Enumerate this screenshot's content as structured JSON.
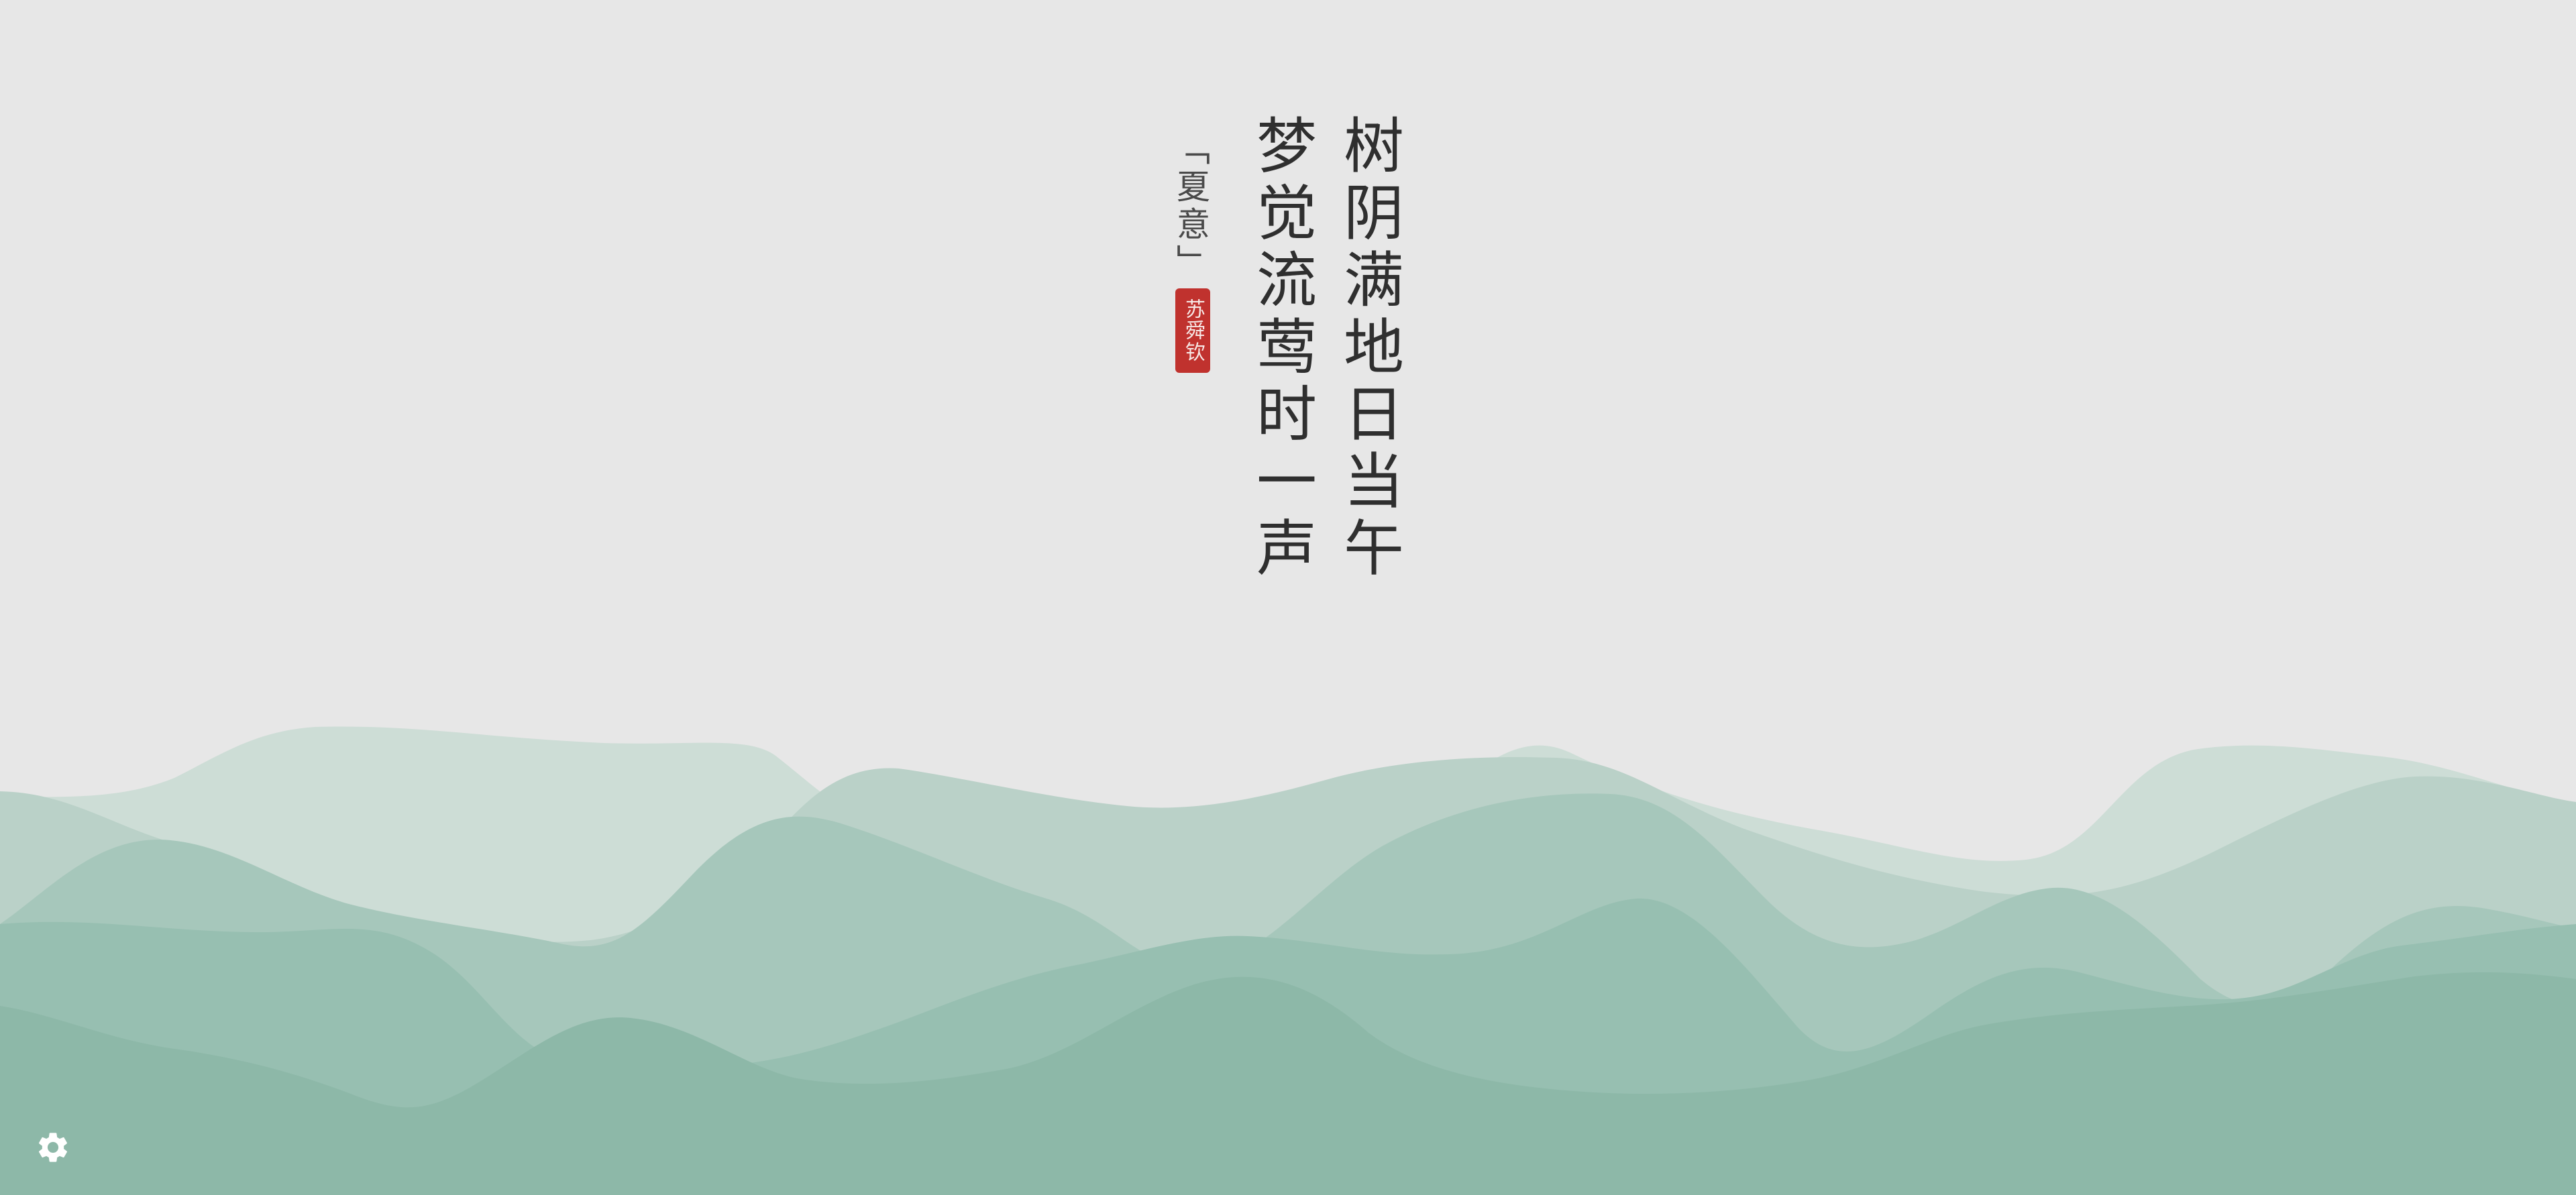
{
  "poem": {
    "line_1": "树阴满地日当午",
    "line_2": "梦觉流莺时一声",
    "title": "「夏意」",
    "author": "苏舜钦"
  },
  "colors": {
    "background": "#e7e7e7",
    "ink": "#2f2f2f",
    "seal": "#c0322e",
    "mountain": "#8db8a8",
    "settings_icon": "#ffffff"
  },
  "icons": {
    "settings": "gear-icon"
  }
}
